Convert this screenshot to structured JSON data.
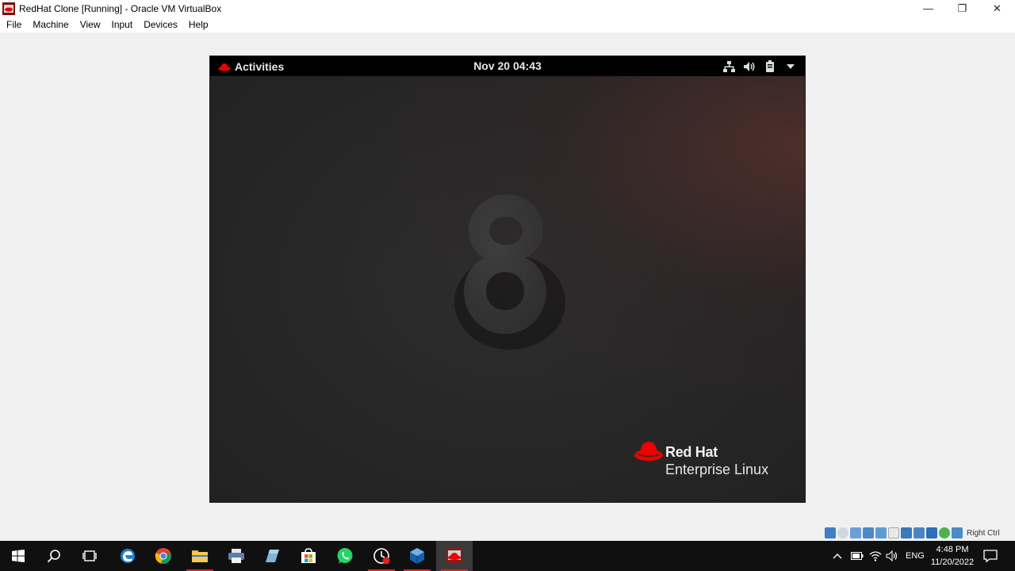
{
  "window": {
    "title": "RedHat Clone [Running] - Oracle VM VirtualBox",
    "controls": {
      "minimize": "—",
      "restore": "❐",
      "close": "✕"
    }
  },
  "menu": [
    "File",
    "Machine",
    "View",
    "Input",
    "Devices",
    "Help"
  ],
  "guest": {
    "activities_label": "Activities",
    "datetime": "Nov 20  04:43",
    "brand_line1": "Red Hat",
    "brand_line2": "Enterprise Linux",
    "tray_icons": [
      "network-icon",
      "volume-icon",
      "battery-icon",
      "dropdown-arrow-icon"
    ]
  },
  "vbox_status": {
    "host_key": "Right Ctrl",
    "icons": [
      "hard-disk-icon",
      "optical-drive-icon",
      "audio-icon",
      "network-adapter-icon",
      "usb-icon",
      "shared-folders-icon",
      "display-icon",
      "video-capture-icon",
      "vt-x-icon",
      "mouse-integration-icon",
      "keyboard-icon"
    ]
  },
  "taskbar": {
    "apps": [
      "start-icon",
      "search-icon",
      "task-view-icon",
      "edge-icon",
      "chrome-icon",
      "file-explorer-icon",
      "printer-app-icon",
      "notepad-app-icon",
      "store-icon",
      "whatsapp-icon",
      "recorder-app-icon",
      "virtualbox-icon",
      "redhat-vm-icon"
    ],
    "language": "ENG",
    "time": "4:48 PM",
    "date": "11/20/2022"
  },
  "colors": {
    "redhat_red": "#ee0000",
    "guest_bg": "#262627",
    "taskbar_bg": "#101010"
  }
}
